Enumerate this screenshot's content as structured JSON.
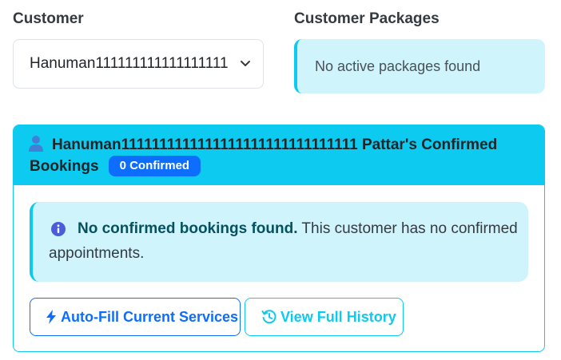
{
  "customer": {
    "label": "Customer",
    "selected": "Hanuman111111111111111111"
  },
  "packages": {
    "label": "Customer Packages",
    "empty_message": "No active packages found"
  },
  "bookings_card": {
    "title": "Hanuman1111111111111111111111111111111 Pattar's Confirmed Bookings",
    "badge": "0 Confirmed",
    "alert_strong": "No confirmed bookings found.",
    "alert_text": " This customer has no confirmed appointments.",
    "autofill_label": "Auto-Fill Current Services",
    "history_label": "View Full History"
  },
  "colors": {
    "info": "#0dcaf0",
    "info_bg": "#cff4fc",
    "primary": "#0d6efd"
  },
  "icons": [
    "chevron-down-icon",
    "user-icon",
    "info-circle-icon",
    "bolt-icon",
    "history-icon"
  ]
}
